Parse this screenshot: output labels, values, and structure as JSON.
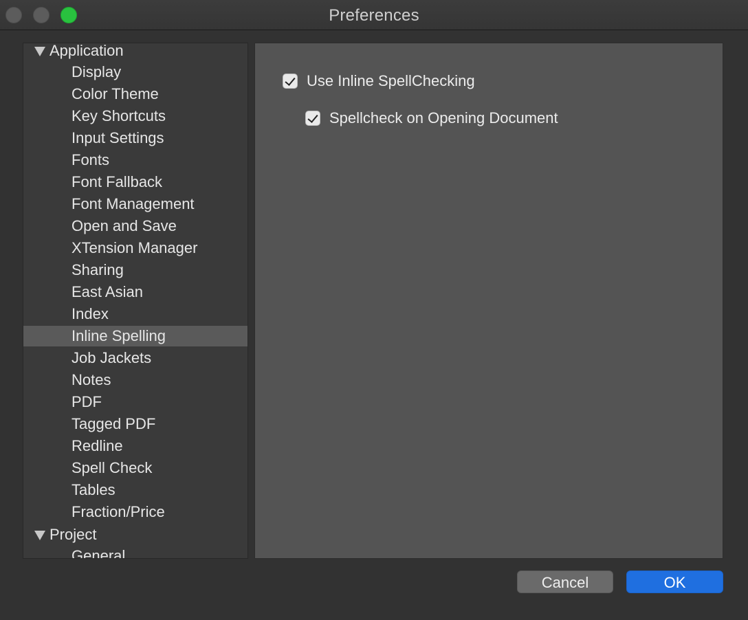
{
  "window": {
    "title": "Preferences"
  },
  "sidebar": {
    "groups": [
      {
        "label": "Application",
        "items": [
          "Display",
          "Color Theme",
          "Key Shortcuts",
          "Input Settings",
          "Fonts",
          "Font Fallback",
          "Font Management",
          "Open and Save",
          "XTension Manager",
          "Sharing",
          "East Asian",
          "Index",
          "Inline Spelling",
          "Job Jackets",
          "Notes",
          "PDF",
          "Tagged PDF",
          "Redline",
          "Spell Check",
          "Tables",
          "Fraction/Price"
        ]
      },
      {
        "label": "Project",
        "items": [
          "General"
        ]
      }
    ],
    "selected": "Inline Spelling"
  },
  "panel": {
    "use_inline_spellchecking": {
      "label": "Use Inline SpellChecking",
      "checked": true
    },
    "spellcheck_on_opening": {
      "label": "Spellcheck on Opening Document",
      "checked": true
    }
  },
  "buttons": {
    "cancel": "Cancel",
    "ok": "OK"
  },
  "colors": {
    "accent": "#1f6fe0",
    "zoom_button": "#29c23f"
  }
}
